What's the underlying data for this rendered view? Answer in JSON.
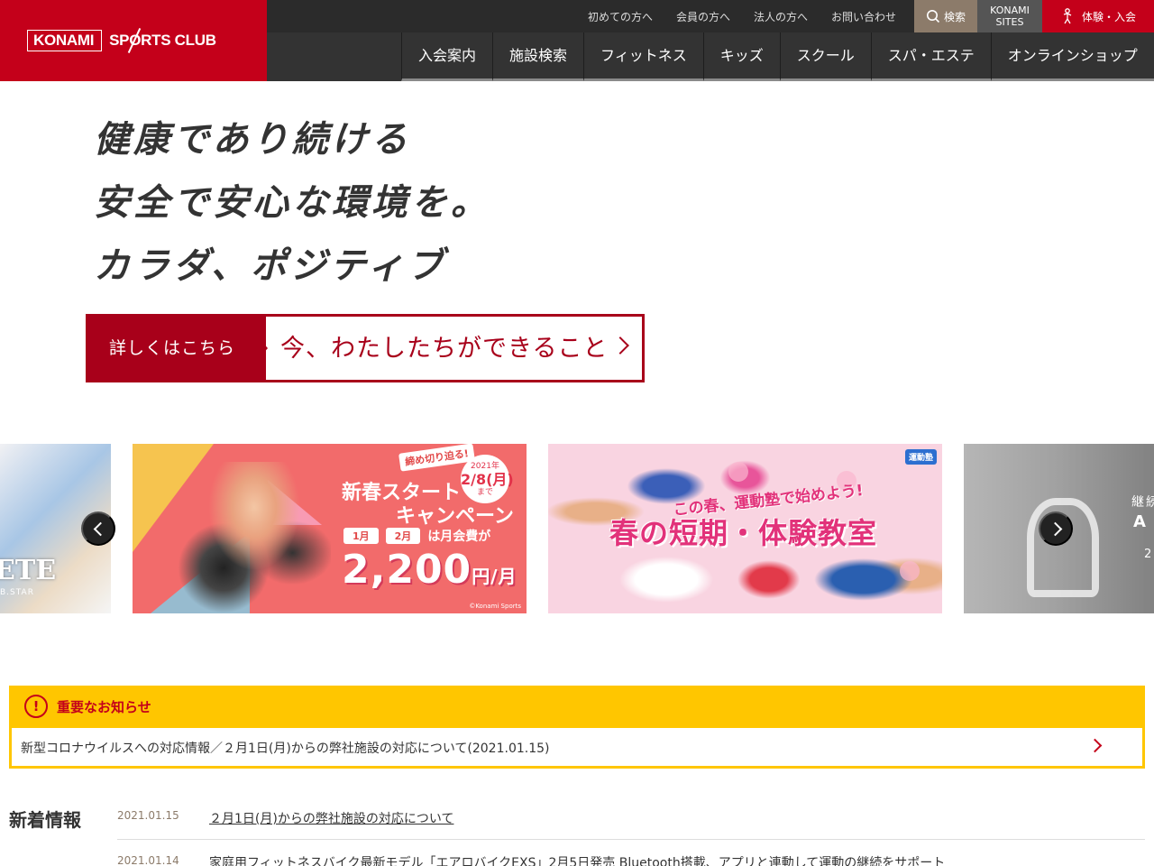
{
  "brand": {
    "logo_part1": "KONAMI",
    "logo_part2": "SPORTS CLUB",
    "red": "#c4001a"
  },
  "utility_nav": {
    "links": [
      "初めての方へ",
      "会員の方へ",
      "法人の方へ",
      "お問い合わせ"
    ],
    "search_label": "検索",
    "sites_label_1": "KONAMI",
    "sites_label_2": "SITES",
    "trial_label": "体験・入会"
  },
  "global_nav": [
    "入会案内",
    "施設検索",
    "フィットネス",
    "キッズ",
    "スクール",
    "スパ・エステ",
    "オンラインショップ"
  ],
  "hero": {
    "lines": [
      "健康であり続ける",
      "安全で安心な環境を。",
      "カラダ、ポジティブ"
    ],
    "cta_left": "詳しくはこちら",
    "cta_right": "今、わたしたちができること"
  },
  "carousel": {
    "slide_a": {
      "text": "ETE",
      "sub": "B.STAR"
    },
    "slide_b": {
      "tag": "締め切り迫る!",
      "badge_year": "2021年",
      "badge_date": "2/8(月)",
      "badge_until": "まで",
      "title1": "新春スタート",
      "title2": "キャンペーン",
      "month1": "1月",
      "month2": "2月",
      "months_text": "は月会費が",
      "price": "2,200",
      "price_unit": "円/月",
      "copyright": "©Konami Sports"
    },
    "slide_c": {
      "logo": "運動塾",
      "title1": "この春、運動塾で始めよう!",
      "title2": "春の短期・体験教室"
    },
    "slide_d": {
      "text1": "継続",
      "text2": "A",
      "text3": "2"
    }
  },
  "notice": {
    "title": "重要なお知らせ",
    "icon": "!",
    "item": "新型コロナウイルスへの対応情報／２月1日(月)からの弊社施設の対応について(2021.01.15)"
  },
  "news": {
    "heading": "新着情報",
    "items": [
      {
        "date": "2021.01.15",
        "title": "２月1日(月)からの弊社施設の対応について"
      },
      {
        "date": "2021.01.14",
        "title": "家庭用フィットネスバイク最新モデル「エアロバイクEXS」2月5日発売 Bluetooth搭載、アプリと連動して運動の継続をサポート"
      }
    ]
  }
}
